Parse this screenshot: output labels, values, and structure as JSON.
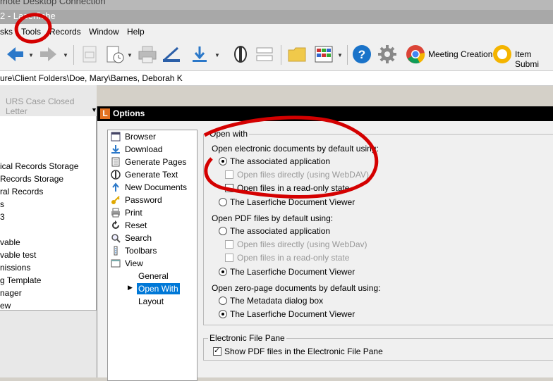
{
  "window": {
    "rdp_title": "mote Desktop Connection",
    "app_title": "2 - Laserfiche"
  },
  "menu": [
    "sks",
    "Tools",
    "Records",
    "Window",
    "Help"
  ],
  "toolbar": {
    "meeting_creation": "Meeting Creation",
    "item_submit": "Item Submi"
  },
  "path": "ure\\Client Folders\\Doe, Mary\\Barnes, Deborah K",
  "template_label": "URS Case Closed Letter",
  "tree_items": [
    "ical Records Storage",
    "Records Storage",
    "ral Records",
    "s",
    "3",
    "",
    "vable",
    "vable test",
    "nissions",
    "g Template",
    "nager",
    "ew"
  ],
  "dialog": {
    "icon_letter": "L",
    "title": "Options",
    "categories": [
      "Browser",
      "Download",
      "Generate Pages",
      "Generate Text",
      "New Documents",
      "Password",
      "Print",
      "Reset",
      "Search",
      "Toolbars",
      "View"
    ],
    "view_sub": [
      "General",
      "Open With",
      "Layout"
    ],
    "open_with": {
      "group_title": "Open with",
      "electronic_heading": "Open electronic documents by default using:",
      "electronic_opts": [
        "The associated application",
        "Open files directly (using WebDAV)",
        "Open files in a read-only state",
        "The Laserfiche Document Viewer"
      ],
      "pdf_heading": "Open PDF files by default using:",
      "pdf_opts": [
        "The associated application",
        "Open files directly (using WebDav)",
        "Open files in a read-only state",
        "The Laserfiche Document Viewer"
      ],
      "zero_heading": "Open zero-page documents by default using:",
      "zero_opts": [
        "The Metadata dialog box",
        "The Laserfiche Document Viewer"
      ]
    },
    "efp": {
      "group_title": "Electronic File Pane",
      "show_pdf": "Show PDF files in the Electronic File Pane"
    }
  }
}
